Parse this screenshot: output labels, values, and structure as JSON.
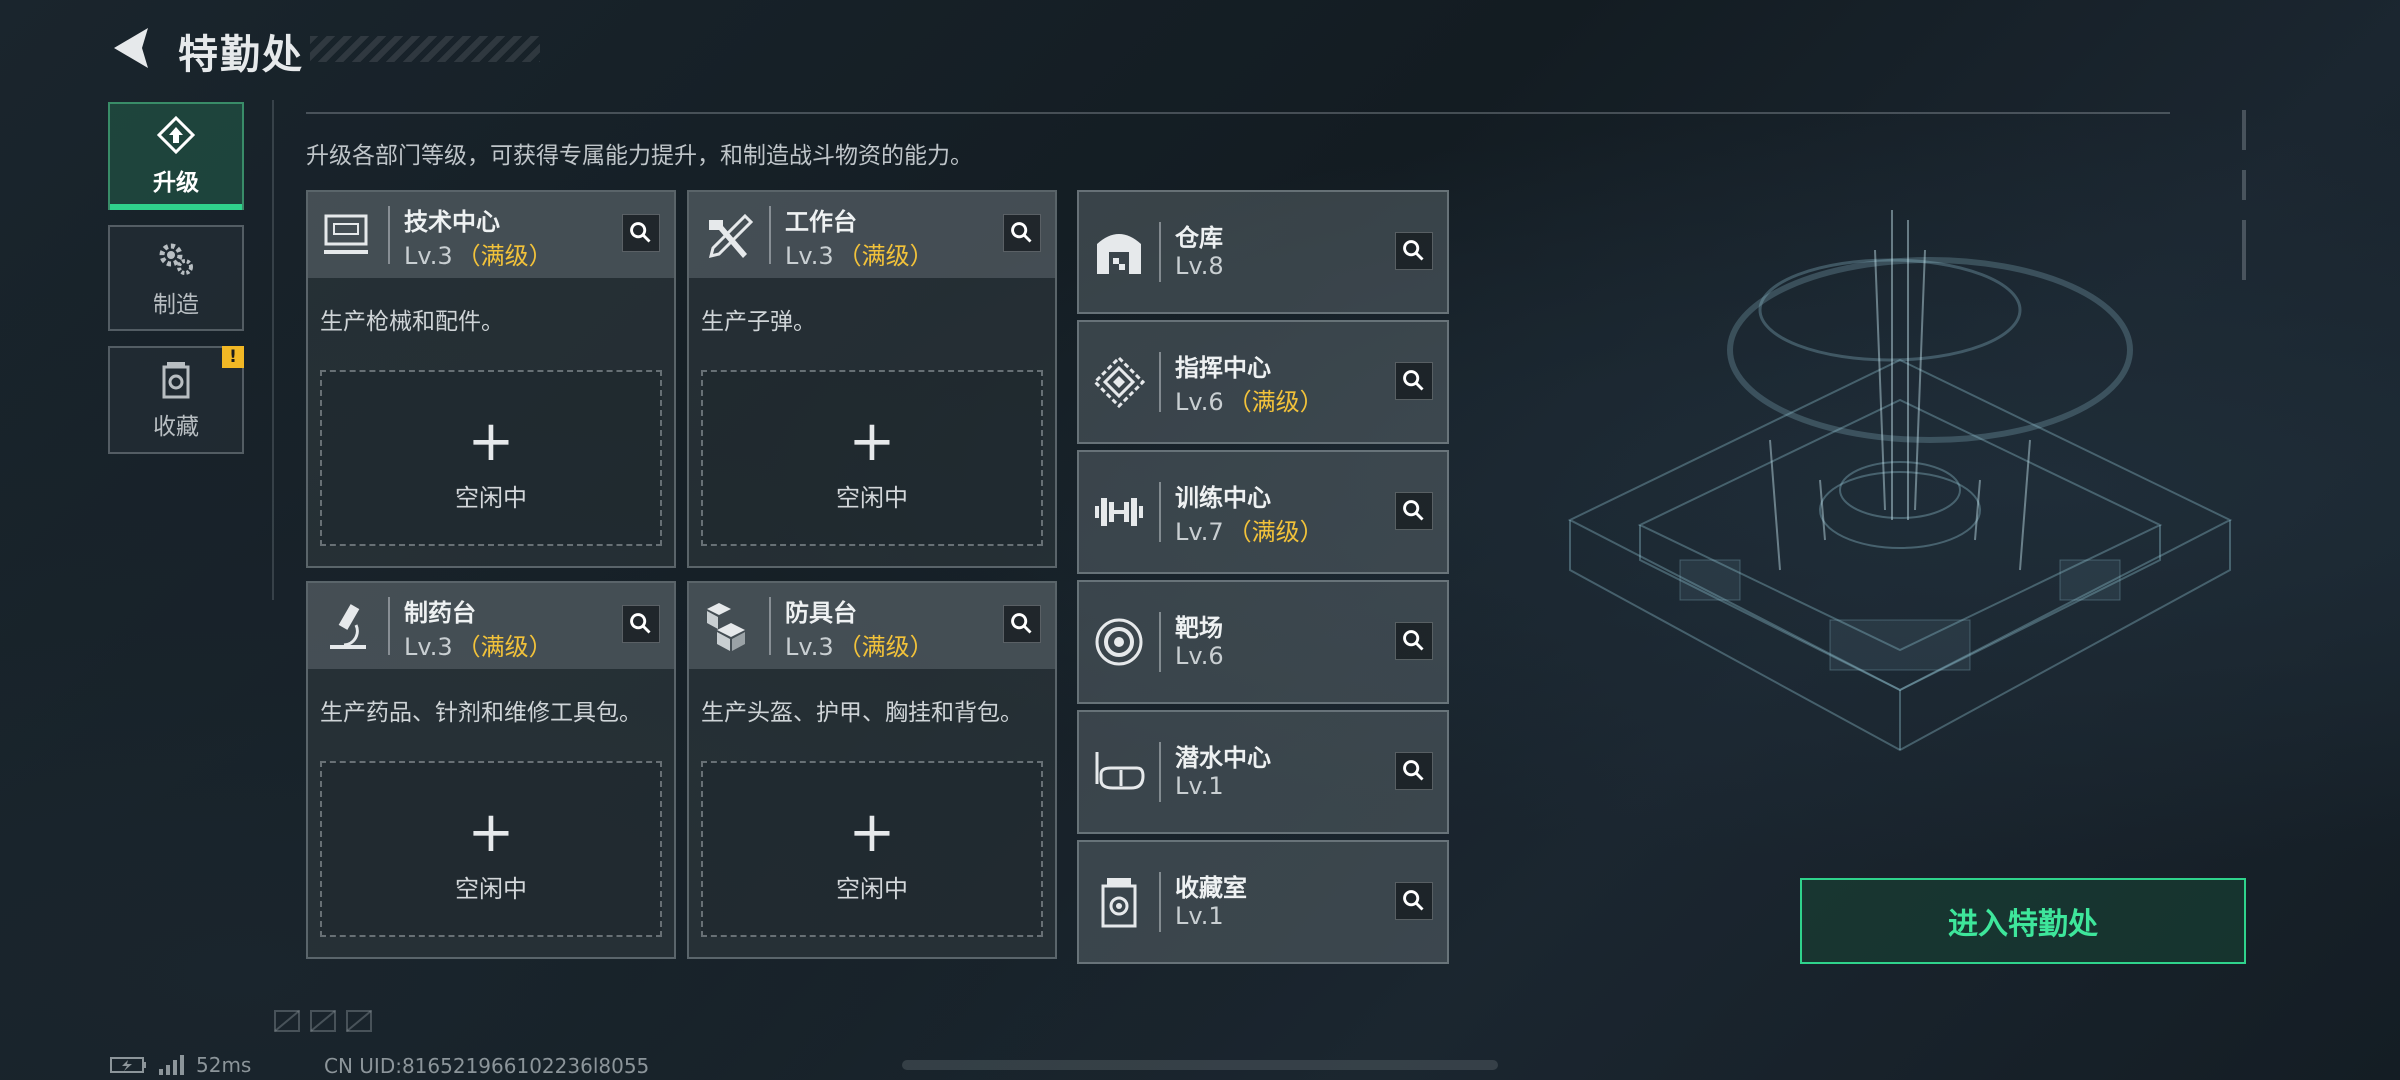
{
  "header": {
    "title": "特勤处"
  },
  "nav": [
    {
      "label": "升级",
      "icon": "upgrade-icon",
      "active": true
    },
    {
      "label": "制造",
      "icon": "gear-icon",
      "active": false
    },
    {
      "label": "收藏",
      "icon": "collection-icon",
      "active": false,
      "badge": "!"
    }
  ],
  "description": "升级各部门等级，可获得专属能力提升，和制造战斗物资的能力。",
  "workshops": [
    {
      "name": "技术中心",
      "level": "Lv.3",
      "max": "（满级）",
      "desc": "生产枪械和配件。",
      "slot_plus": "+",
      "slot_status": "空闲中",
      "icon": "computer-icon"
    },
    {
      "name": "工作台",
      "level": "Lv.3",
      "max": "（满级）",
      "desc": "生产子弹。",
      "slot_plus": "+",
      "slot_status": "空闲中",
      "icon": "tools-icon"
    },
    {
      "name": "制药台",
      "level": "Lv.3",
      "max": "（满级）",
      "desc": "生产药品、针剂和维修工具包。",
      "slot_plus": "+",
      "slot_status": "空闲中",
      "icon": "microscope-icon"
    },
    {
      "name": "防具台",
      "level": "Lv.3",
      "max": "（满级）",
      "desc": "生产头盔、护甲、胸挂和背包。",
      "slot_plus": "+",
      "slot_status": "空闲中",
      "icon": "boxes-icon"
    }
  ],
  "facilities": [
    {
      "name": "仓库",
      "level": "Lv.8",
      "max": "",
      "icon": "warehouse-icon"
    },
    {
      "name": "指挥中心",
      "level": "Lv.6",
      "max": "（满级）",
      "icon": "command-icon"
    },
    {
      "name": "训练中心",
      "level": "Lv.7",
      "max": "（满级）",
      "icon": "dumbbell-icon"
    },
    {
      "name": "靶场",
      "level": "Lv.6",
      "max": "",
      "icon": "target-icon"
    },
    {
      "name": "潜水中心",
      "level": "Lv.1",
      "max": "",
      "icon": "diving-mask-icon"
    },
    {
      "name": "收藏室",
      "level": "Lv.1",
      "max": "",
      "icon": "collection-icon"
    }
  ],
  "enter_button": "进入特勤处",
  "status": {
    "ping": "52ms",
    "uid": "CN UID:816521966102236l8055"
  },
  "colors": {
    "accent": "#2fd38c",
    "max_level": "#f2c23a",
    "badge": "#f2b825"
  }
}
